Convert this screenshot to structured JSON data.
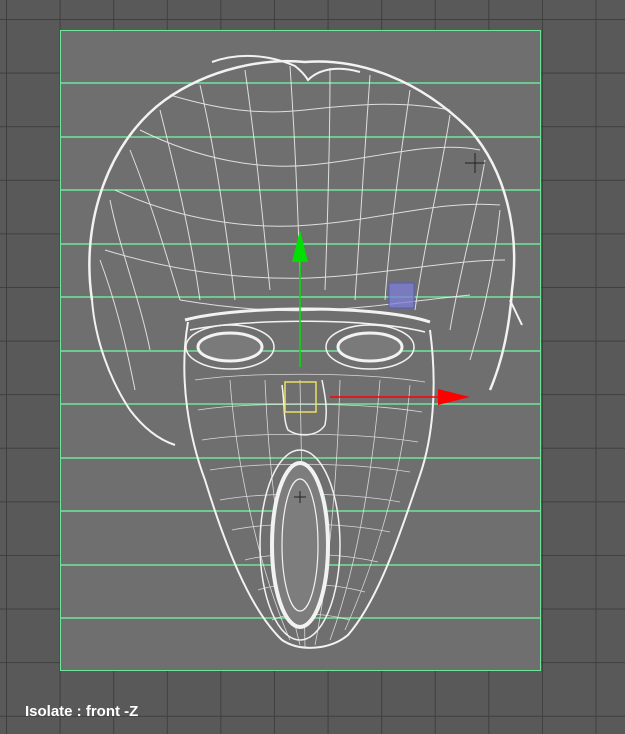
{
  "viewport": {
    "label": "Isolate : front -Z",
    "view_axis": "front -Z",
    "mode": "Isolate"
  },
  "scene": {
    "object": "head wireframe mesh",
    "gizmo": {
      "type": "move-manipulator",
      "y_axis_color": "#00e000",
      "x_axis_color": "#ff0000",
      "center_color": "#e8e060"
    },
    "guide_color": "#6fe59a",
    "wire_color": "#f0f0f0",
    "selected_handle_color": "#7d7dd8"
  }
}
